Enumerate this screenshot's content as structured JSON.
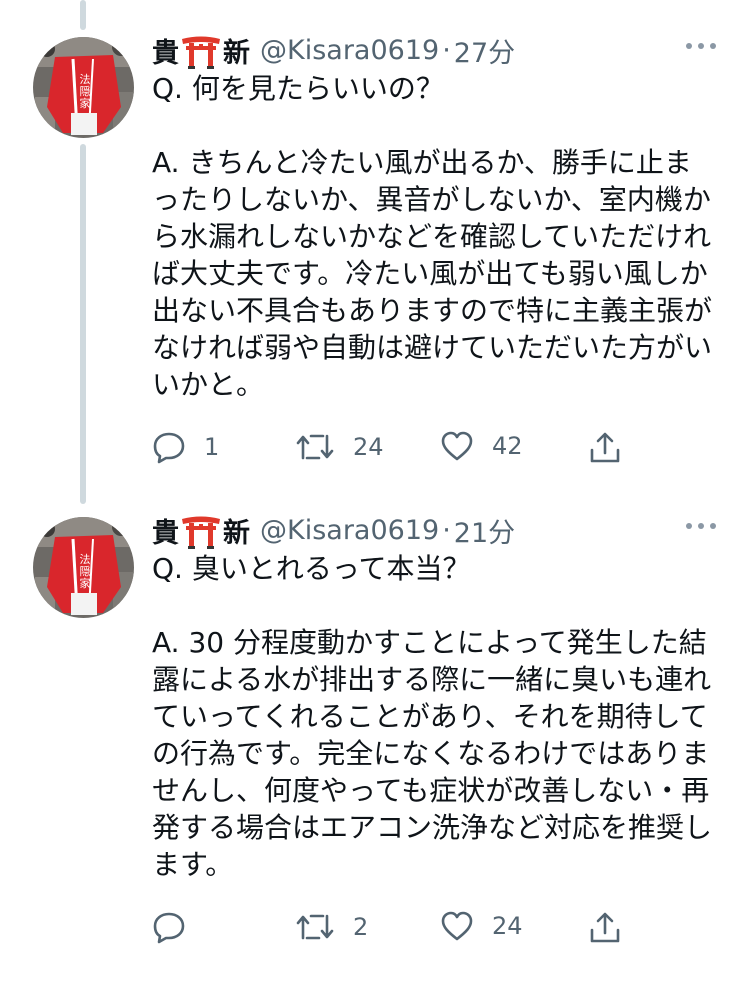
{
  "tweets": [
    {
      "author_name": "貴",
      "author_name_suffix": "新",
      "handle": "@Kisara0619",
      "separator": "·",
      "time": "27分",
      "question": "Q. 何を見たらいいの？",
      "answer_lines": [
        "A. きちんと冷たい風が出るか、勝手に止ま",
        "ったりしないか、異音がしないか、室内機か",
        "ら水漏れしないかなどを確認していただけれ",
        "ば大丈夫です。冷たい風が出ても弱い風しか",
        "出ない不具合もありますので特に主義主張が",
        "なければ弱や自動は避けていただいた方がい",
        "いかと。"
      ],
      "reply_count": "1",
      "retweet_count": "24",
      "like_count": "42",
      "avatar_text": "法 隠 家"
    },
    {
      "author_name": "貴",
      "author_name_suffix": "新",
      "handle": "@Kisara0619",
      "separator": "·",
      "time": "21分",
      "question": "Q. 臭いとれるって本当？",
      "answer_lines": [
        "A. 30 分程度動かすことによって発生した結",
        "露による水が排出する際に一緒に臭いも連れ",
        "ていってくれることがあり、それを期待して",
        "の行為です。完全になくなるわけではありま",
        "せんし、何度やっても症状が改善しない・再",
        "発する場合はエアコン洗浄など対応を推奨し",
        "ます。"
      ],
      "reply_count": "",
      "retweet_count": "2",
      "like_count": "24",
      "avatar_text": "法 隠 家"
    }
  ],
  "colors": {
    "accent_red": "#d9262c",
    "muted": "#536471",
    "thread_line": "#cfd9de"
  },
  "icons": [
    "reply-icon",
    "retweet-icon",
    "like-icon",
    "share-icon",
    "more-icon",
    "torii-emoji-icon"
  ]
}
